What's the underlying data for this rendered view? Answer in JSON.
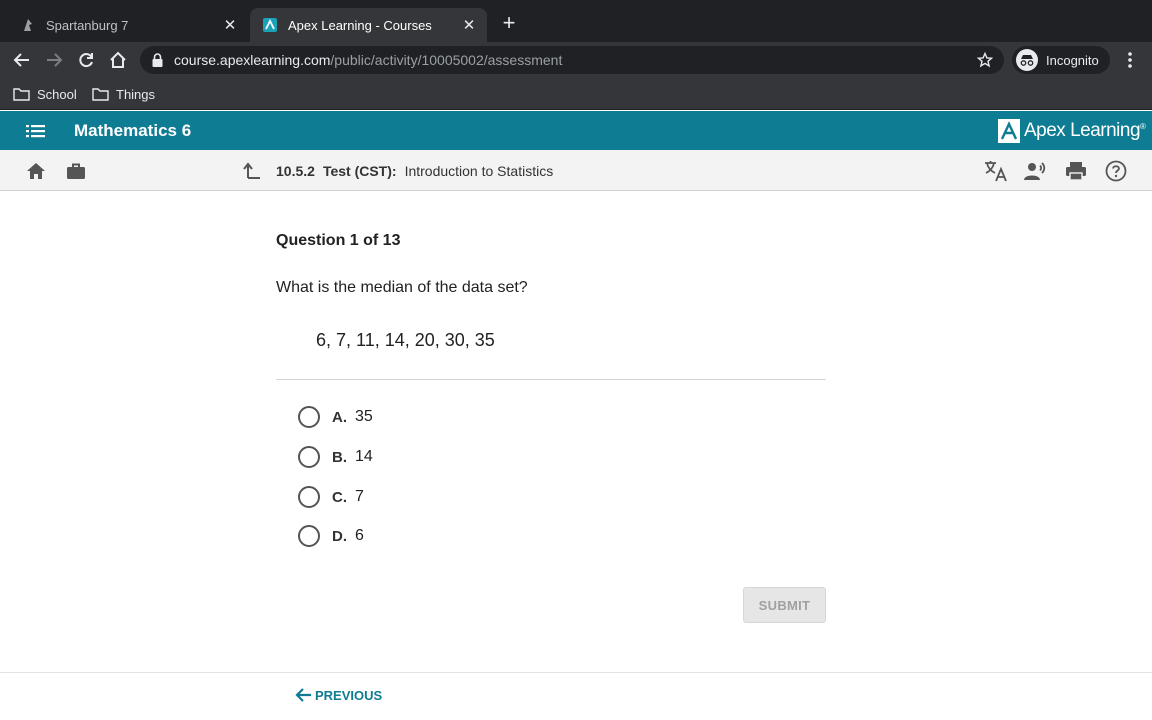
{
  "browser": {
    "tabs": [
      {
        "title": "Spartanburg 7",
        "favicon": "spartan-favicon",
        "active": false
      },
      {
        "title": "Apex Learning - Courses",
        "favicon": "apex-favicon",
        "active": true
      }
    ],
    "url": {
      "host": "course.apexlearning.com",
      "path": "/public/activity/10005002/assessment"
    },
    "profile_label": "Incognito",
    "bookmarks": [
      {
        "label": "School",
        "icon": "folder-icon"
      },
      {
        "label": "Things",
        "icon": "folder-icon"
      }
    ]
  },
  "app": {
    "course_title": "Mathematics 6",
    "brand": "Apex Learning",
    "brand_tm": "®",
    "breadcrumb": {
      "number": "10.5.2",
      "kind": "Test (CST):",
      "title": "Introduction to Statistics"
    }
  },
  "question": {
    "heading": "Question 1 of 13",
    "prompt": "What is the median of the data set?",
    "data_set": "6, 7, 11, 14, 20, 30, 35",
    "choices": [
      {
        "letter": "A.",
        "text": "35"
      },
      {
        "letter": "B.",
        "text": "14"
      },
      {
        "letter": "C.",
        "text": "7"
      },
      {
        "letter": "D.",
        "text": "6"
      }
    ],
    "submit_label": "SUBMIT"
  },
  "footer": {
    "previous_label": "PREVIOUS"
  },
  "colors": {
    "chrome_dark": "#202124",
    "chrome_mid": "#35363a",
    "apex_teal": "#0e7c93"
  }
}
